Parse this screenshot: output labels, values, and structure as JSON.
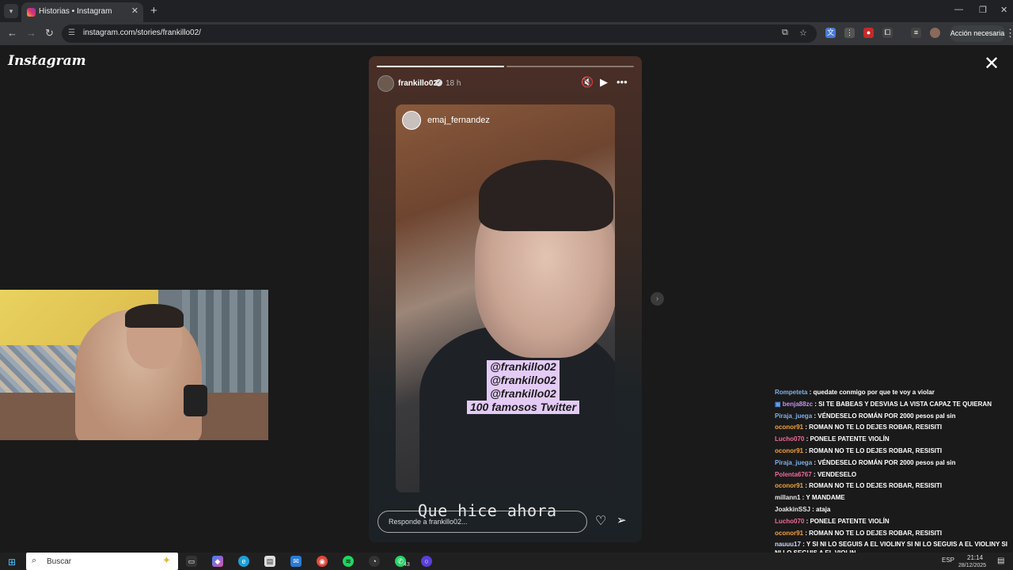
{
  "browser": {
    "tab_title": "Historias • Instagram",
    "url": "instagram.com/stories/frankillo02/",
    "action_label": "Acción necesaria"
  },
  "instagram": {
    "logo": "Instagram",
    "story": {
      "username": "frankillo02",
      "time": "18 h",
      "progress": [
        1.0,
        0.0
      ],
      "inner_username": "emaj_fernandez",
      "sticker_lines": [
        "@frankillo02",
        "@frankillo02",
        "@frankillo02",
        "100 famosos Twitter"
      ],
      "caption": "Que hice ahora",
      "reply_placeholder": "Responde a frankillo02..."
    }
  },
  "chat": [
    {
      "name": "Rompeteta",
      "color": "#7fb0e8",
      "text": ": quedate conmigo por que te voy a violar"
    },
    {
      "name": "benja88zc",
      "color": "#c28ef0",
      "text": ": SI TE BABEAS Y DESVIAS LA VISTA CAPAZ TE QUIERAN",
      "badge": true
    },
    {
      "name": "Piraja_juega",
      "color": "#7fb0e8",
      "text": ": VÉNDESELO ROMÁN POR 2000 pesos pal sin"
    },
    {
      "name": "oconor91",
      "color": "#f3a23a",
      "text": ": ROMAN NO TE LO DEJES ROBAR, RESISITI"
    },
    {
      "name": "Lucho070",
      "color": "#f06a9a",
      "text": ": PONELE PATENTE VIOLÍN"
    },
    {
      "name": "oconor91",
      "color": "#f3a23a",
      "text": ": ROMAN NO TE LO DEJES ROBAR, RESISITI"
    },
    {
      "name": "Piraja_juega",
      "color": "#7fb0e8",
      "text": ": VÉNDESELO ROMÁN POR 2000 pesos pal sin"
    },
    {
      "name": "Polenta6767",
      "color": "#f06a9a",
      "text": ": VENDESELO"
    },
    {
      "name": "oconor91",
      "color": "#f3a23a",
      "text": ": ROMAN NO TE LO DEJES ROBAR, RESISITI"
    },
    {
      "name": "millann1",
      "color": "#e8e8e8",
      "text": ": Y MANDAME"
    },
    {
      "name": "JoakkinSSJ",
      "color": "#e8e8e8",
      "text": ": ataja"
    },
    {
      "name": "Lucho070",
      "color": "#f06a9a",
      "text": ": PONELE PATENTE VIOLÍN"
    },
    {
      "name": "oconor91",
      "color": "#f3a23a",
      "text": ": ROMAN NO TE LO DEJES ROBAR, RESISITI"
    },
    {
      "name": "nauuu17",
      "color": "#cfd6ff",
      "text": ": Y SI NI LO SEGUIS A EL VIOLINY SI NI LO SEGUIS A EL VIOLINY SI NI LO SEGUIS A EL VIOLIN",
      "wrap": true
    },
    {
      "name": "oconor91",
      "color": "#f3a23a",
      "text": ": ROMAN NO TE LO DEJES ROBAR, RESISITI"
    }
  ],
  "taskbar": {
    "search_placeholder": "Buscar",
    "whatsapp_count": "43",
    "language": "ESP",
    "time": "21:14",
    "date": "28/12/2025"
  }
}
